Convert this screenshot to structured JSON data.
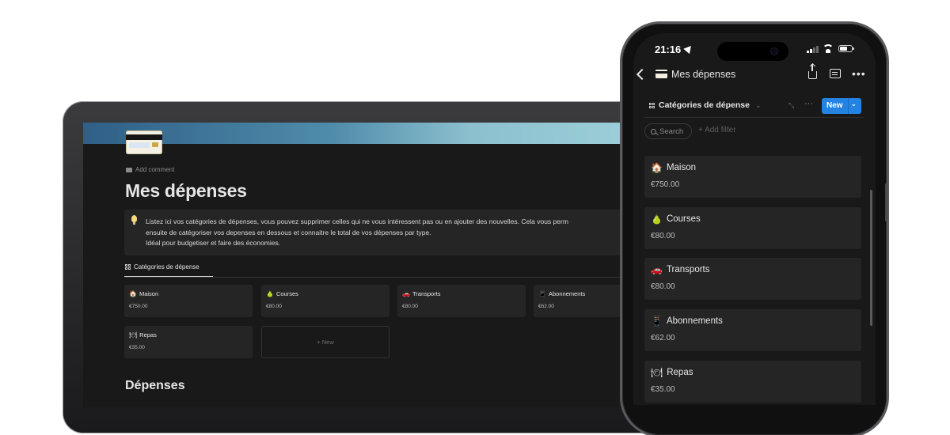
{
  "laptop": {
    "add_comment": "Add comment",
    "page_title": "Mes dépenses",
    "callout": {
      "icon": "lightbulb",
      "text": "Listez ici vos catégories de dépenses, vous pouvez supprimer celles qui ne vous intéressent pas ou en ajouter des nouvelles. Cela vous perm\nensuite de catégoriser vos depenses en dessous et connaitre le total de vos dépenses par type.\nIdéal pour budgetiser et faire des économies."
    },
    "view_tab": "Catégories de dépense",
    "cards": [
      {
        "emoji": "🏠",
        "name": "Maison",
        "amount": "€750.00"
      },
      {
        "emoji": "🍐",
        "name": "Courses",
        "amount": "€80.00"
      },
      {
        "emoji": "🚗",
        "name": "Transports",
        "amount": "€80.00"
      },
      {
        "emoji": "📱",
        "name": "Abonnements",
        "amount": "€62.00"
      },
      {
        "emoji": "🍽",
        "name": "Repas",
        "amount": "€35.00"
      }
    ],
    "new_card": "+ New",
    "section_title": "Dépenses"
  },
  "phone": {
    "status": {
      "time": "21:16"
    },
    "nav": {
      "title": "Mes dépenses"
    },
    "view": {
      "label": "Catégories de dépense",
      "new_button": "New"
    },
    "filters": {
      "search": "Search",
      "add_filter": "+ Add filter"
    },
    "cards": [
      {
        "emoji": "🏠",
        "name": "Maison",
        "amount": "€750.00"
      },
      {
        "emoji": "🍐",
        "name": "Courses",
        "amount": "€80.00"
      },
      {
        "emoji": "🚗",
        "name": "Transports",
        "amount": "€80.00"
      },
      {
        "emoji": "📱",
        "name": "Abonnements",
        "amount": "€62.00"
      },
      {
        "emoji": "🍽",
        "name": "Repas",
        "amount": "€35.00"
      }
    ]
  },
  "colors": {
    "background": "#191919",
    "card": "#252525",
    "accent_blue": "#2483e2",
    "cover_gradient": [
      "#2f5f86",
      "#9ccfd8"
    ]
  }
}
